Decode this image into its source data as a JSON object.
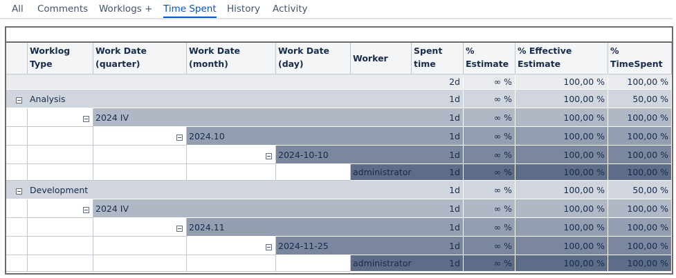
{
  "tabs": [
    {
      "label": "All"
    },
    {
      "label": "Comments"
    },
    {
      "label": "Worklogs +"
    },
    {
      "label": "Time Spent"
    },
    {
      "label": "History"
    },
    {
      "label": "Activity"
    }
  ],
  "active_tab": "Time Spent",
  "table": {
    "headers": {
      "worklog_type": [
        "Worklog",
        "Type"
      ],
      "quarter": [
        "Work Date",
        "(quarter)"
      ],
      "month": [
        "Work Date",
        "(month)"
      ],
      "day": [
        "Work Date",
        "(day)"
      ],
      "worker": "Worker",
      "spent": [
        "Spent",
        "time"
      ],
      "pct_estimate": [
        "%",
        "Estimate"
      ],
      "pct_effective": [
        "% Effective",
        "Estimate"
      ],
      "pct_timespent": [
        "%",
        "TimeSpent"
      ]
    },
    "total": {
      "spent": "2d",
      "pct_estimate": "∞ %",
      "pct_effective": "100,00 %",
      "pct_timespent": "100,00 %"
    },
    "groups": [
      {
        "type": "Analysis",
        "values": {
          "spent": "1d",
          "pct_estimate": "∞ %",
          "pct_effective": "100,00 %",
          "pct_timespent": "50,00 %"
        },
        "quarter": {
          "label": "2024 IV",
          "values": {
            "spent": "1d",
            "pct_estimate": "∞ %",
            "pct_effective": "100,00 %",
            "pct_timespent": "100,00 %"
          }
        },
        "month": {
          "label": "2024.10",
          "values": {
            "spent": "1d",
            "pct_estimate": "∞ %",
            "pct_effective": "100,00 %",
            "pct_timespent": "100,00 %"
          }
        },
        "day": {
          "label": "2024-10-10",
          "values": {
            "spent": "1d",
            "pct_estimate": "∞ %",
            "pct_effective": "100,00 %",
            "pct_timespent": "100,00 %"
          }
        },
        "worker": {
          "label": "administrator",
          "values": {
            "spent": "1d",
            "pct_estimate": "∞ %",
            "pct_effective": "100,00 %",
            "pct_timespent": "100,00 %"
          }
        }
      },
      {
        "type": "Development",
        "values": {
          "spent": "1d",
          "pct_estimate": "∞ %",
          "pct_effective": "100,00 %",
          "pct_timespent": "50,00 %"
        },
        "quarter": {
          "label": "2024 IV",
          "values": {
            "spent": "1d",
            "pct_estimate": "∞ %",
            "pct_effective": "100,00 %",
            "pct_timespent": "100,00 %"
          }
        },
        "month": {
          "label": "2024.11",
          "values": {
            "spent": "1d",
            "pct_estimate": "∞ %",
            "pct_effective": "100,00 %",
            "pct_timespent": "100,00 %"
          }
        },
        "day": {
          "label": "2024-11-25",
          "values": {
            "spent": "1d",
            "pct_estimate": "∞ %",
            "pct_effective": "100,00 %",
            "pct_timespent": "100,00 %"
          }
        },
        "worker": {
          "label": "administrator",
          "values": {
            "spent": "1d",
            "pct_estimate": "∞ %",
            "pct_effective": "100,00 %",
            "pct_timespent": "100,00 %"
          }
        }
      }
    ]
  },
  "colors": {
    "level1": "#d0d5de",
    "level2": "#b0b8c6",
    "level3": "#939eb1",
    "level4": "#7a879e",
    "level5": "#5d6c87",
    "header": "#f4f5f7",
    "total": "#e9ebef"
  },
  "icons": {
    "refresh": "refresh-icon",
    "collapse": "collapse-icon"
  }
}
